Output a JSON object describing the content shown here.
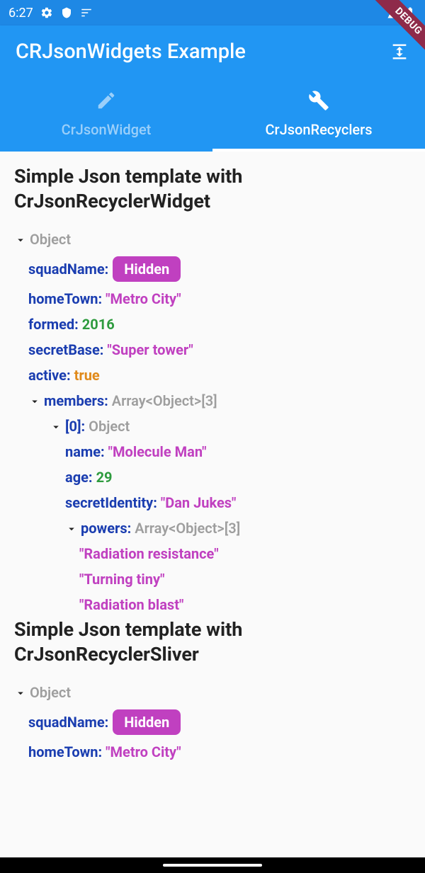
{
  "status": {
    "time": "6:27"
  },
  "debug": {
    "label": "DEBUG"
  },
  "appbar": {
    "title": "CRJsonWidgets Example"
  },
  "tabs": {
    "widget": "CrJsonWidget",
    "recyclers": "CrJsonRecyclers"
  },
  "section1": {
    "title": "Simple Json template with CrJsonRecyclerWidget"
  },
  "section2": {
    "title": "Simple Json template with CrJsonRecyclerSliver"
  },
  "json": {
    "rootType": "Object",
    "squadName": {
      "key": "squadName:",
      "badge": "Hidden"
    },
    "homeTown": {
      "key": "homeTown:",
      "val": "\"Metro City\""
    },
    "formed": {
      "key": "formed:",
      "val": "2016"
    },
    "secretBase": {
      "key": "secretBase:",
      "val": "\"Super tower\""
    },
    "active": {
      "key": "active:",
      "val": "true"
    },
    "members": {
      "key": "members:",
      "type": "Array<Object>[3]"
    },
    "m0": {
      "key": "[0]:",
      "type": "Object"
    },
    "m0name": {
      "key": "name:",
      "val": "\"Molecule Man\""
    },
    "m0age": {
      "key": "age:",
      "val": "29"
    },
    "m0secret": {
      "key": "secretIdentity:",
      "val": "\"Dan Jukes\""
    },
    "m0powers": {
      "key": "powers:",
      "type": "Array<Object>[3]"
    },
    "m0p0": "\"Radiation resistance\"",
    "m0p1": "\"Turning tiny\"",
    "m0p2": "\"Radiation blast\""
  }
}
